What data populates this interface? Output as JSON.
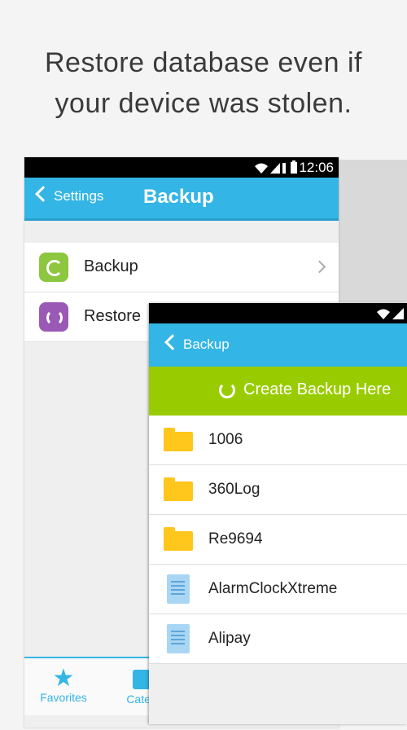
{
  "headline": {
    "line1": "Restore database even if",
    "line2": "your device was stolen."
  },
  "back_screen": {
    "status_time": "12:06",
    "back_label": "Settings",
    "title": "Backup",
    "menu": [
      {
        "label": "Backup",
        "icon": "backup-icon",
        "color": "#8dc63f"
      },
      {
        "label": "Restore",
        "icon": "restore-icon",
        "color": "#9b59b6"
      }
    ],
    "nav": [
      {
        "label": "Favorites",
        "icon": "star-icon"
      },
      {
        "label": "Categ",
        "icon": "categories-icon"
      }
    ]
  },
  "front_screen": {
    "back_label": "Backup",
    "create_label": "Create Backup Here",
    "files": [
      {
        "name": "1006",
        "type": "folder"
      },
      {
        "name": "360Log",
        "type": "folder"
      },
      {
        "name": "Re9694",
        "type": "folder"
      },
      {
        "name": "AlarmClockXtreme",
        "type": "document"
      },
      {
        "name": "Alipay",
        "type": "document"
      }
    ]
  },
  "colors": {
    "accent": "#33b5e5",
    "create_bar": "#99cc00",
    "folder": "#ffc61b"
  }
}
